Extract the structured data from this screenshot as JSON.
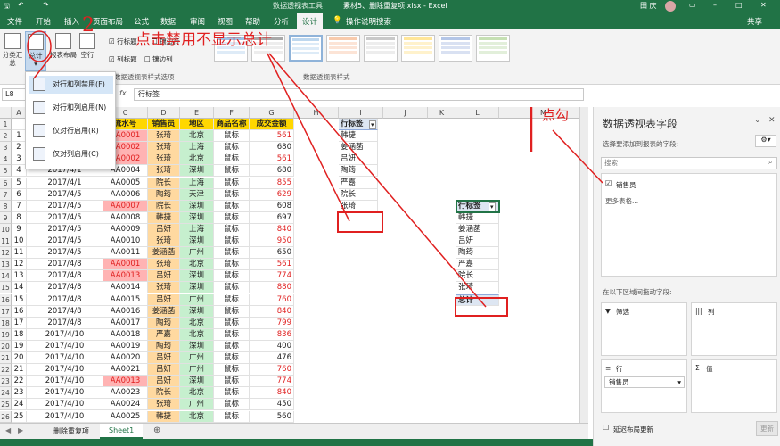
{
  "title_bar": {
    "pivot_tools": "数据透视表工具",
    "doc_title": "素材5、删除重复项.xlsx  -  Excel",
    "user": "田 庆"
  },
  "tabs": [
    "文件",
    "开始",
    "插入",
    "页面布局",
    "公式",
    "数据",
    "审阅",
    "视图",
    "帮助",
    "分析",
    "设计",
    "操作说明搜索"
  ],
  "tab_share": "共享",
  "ribbon": {
    "subtotals": "分类汇总",
    "grand_totals": "总计",
    "report_layout": "报表布局",
    "blank_rows": "空行",
    "row_headers": "行标题",
    "banded_rows": "镶边行",
    "column_headers": "列标题",
    "banded_columns": "镶边列",
    "style_options_group": "数据透视表样式选项",
    "styles_group": "数据透视表样式"
  },
  "name_box": "L8",
  "fx": "fx",
  "formula_value": "行标签",
  "menu_items": [
    "对行和列禁用(F)",
    "对行和列启用(N)",
    "仅对行启用(R)",
    "仅对列启用(C)"
  ],
  "annotations": {
    "number": "2",
    "instruction": "点击禁用不显示总计",
    "check": "点勾"
  },
  "columns": [
    "A",
    "B",
    "C",
    "D",
    "E",
    "F",
    "G",
    "H",
    "I",
    "J",
    "K",
    "L",
    "M"
  ],
  "table_headers": [
    "",
    "日期",
    "流水号",
    "销售员",
    "地区",
    "商品名称",
    "成交金额"
  ],
  "rows": [
    [
      "1",
      "2017/4/1",
      "AA0001",
      "张琦",
      "北京",
      "鼠标",
      "561"
    ],
    [
      "2",
      "2017/4/1",
      "AA0002",
      "张琦",
      "上海",
      "鼠标",
      "680"
    ],
    [
      "3",
      "2017/4/1",
      "AA0002",
      "张琦",
      "北京",
      "鼠标",
      "561"
    ],
    [
      "4",
      "2017/4/1",
      "AA0004",
      "张琦",
      "深圳",
      "鼠标",
      "680"
    ],
    [
      "5",
      "2017/4/1",
      "AA0005",
      "院长",
      "上海",
      "鼠标",
      "855"
    ],
    [
      "6",
      "2017/4/5",
      "AA0006",
      "陶筠",
      "天津",
      "鼠标",
      "629"
    ],
    [
      "7",
      "2017/4/5",
      "AA0007",
      "院长",
      "深圳",
      "鼠标",
      "608"
    ],
    [
      "8",
      "2017/4/5",
      "AA0008",
      "韩捷",
      "深圳",
      "鼠标",
      "697"
    ],
    [
      "9",
      "2017/4/5",
      "AA0009",
      "吕妍",
      "上海",
      "鼠标",
      "840"
    ],
    [
      "10",
      "2017/4/5",
      "AA0010",
      "张琦",
      "深圳",
      "鼠标",
      "950"
    ],
    [
      "11",
      "2017/4/5",
      "AA0011",
      "姜涵菡",
      "广州",
      "鼠标",
      "650"
    ],
    [
      "12",
      "2017/4/8",
      "AA0001",
      "张琦",
      "北京",
      "鼠标",
      "561"
    ],
    [
      "13",
      "2017/4/8",
      "AA0013",
      "吕妍",
      "深圳",
      "鼠标",
      "774"
    ],
    [
      "14",
      "2017/4/8",
      "AA0014",
      "张琦",
      "深圳",
      "鼠标",
      "880"
    ],
    [
      "15",
      "2017/4/8",
      "AA0015",
      "吕妍",
      "广州",
      "鼠标",
      "760"
    ],
    [
      "16",
      "2017/4/8",
      "AA0016",
      "姜涵菡",
      "深圳",
      "鼠标",
      "840"
    ],
    [
      "17",
      "2017/4/8",
      "AA0017",
      "陶筠",
      "北京",
      "鼠标",
      "799"
    ],
    [
      "18",
      "2017/4/10",
      "AA0018",
      "严嘉",
      "北京",
      "鼠标",
      "836"
    ],
    [
      "19",
      "2017/4/10",
      "AA0019",
      "陶筠",
      "深圳",
      "鼠标",
      "400"
    ],
    [
      "20",
      "2017/4/10",
      "AA0020",
      "吕妍",
      "广州",
      "鼠标",
      "476"
    ],
    [
      "21",
      "2017/4/10",
      "AA0021",
      "吕妍",
      "广州",
      "鼠标",
      "760"
    ],
    [
      "22",
      "2017/4/10",
      "AA0013",
      "吕妍",
      "深圳",
      "鼠标",
      "774"
    ],
    [
      "23",
      "2017/4/10",
      "AA0023",
      "院长",
      "北京",
      "鼠标",
      "840"
    ],
    [
      "24",
      "2017/4/10",
      "AA0024",
      "张琦",
      "广州",
      "鼠标",
      "450"
    ],
    [
      "25",
      "2017/4/10",
      "AA0025",
      "韩捷",
      "北京",
      "鼠标",
      "560"
    ]
  ],
  "pivot1": {
    "header": "行标签",
    "items": [
      "韩捷",
      "姜涵菡",
      "吕妍",
      "陶筠",
      "严嘉",
      "院长",
      "张琦"
    ]
  },
  "pivot2": {
    "header": "行标签",
    "items": [
      "韩捷",
      "姜涵菡",
      "吕妍",
      "陶筠",
      "严嘉",
      "院长",
      "张琦"
    ],
    "total": "总计"
  },
  "pane": {
    "title": "数据透视表字段",
    "subtitle": "选择要添加到报表的字段:",
    "search_placeholder": "搜索",
    "field": "销售员",
    "more_tables": "更多表格...",
    "drag_hint": "在以下区域间拖动字段:",
    "filters": "筛选",
    "columns": "列",
    "rows": "行",
    "values": "值",
    "row_field": "销售员",
    "defer": "延迟布局更新",
    "update": "更新"
  },
  "sheets": [
    "删除重复项",
    "Sheet1"
  ],
  "colors": {
    "excel_green": "#217346",
    "header_yellow": "#ffd700",
    "dup_pink": "#ffb3b3",
    "seller_orange": "#ffd9a0",
    "region_green": "#c6efce",
    "amount_red": "#e02020",
    "annotation_red": "#e02020"
  }
}
